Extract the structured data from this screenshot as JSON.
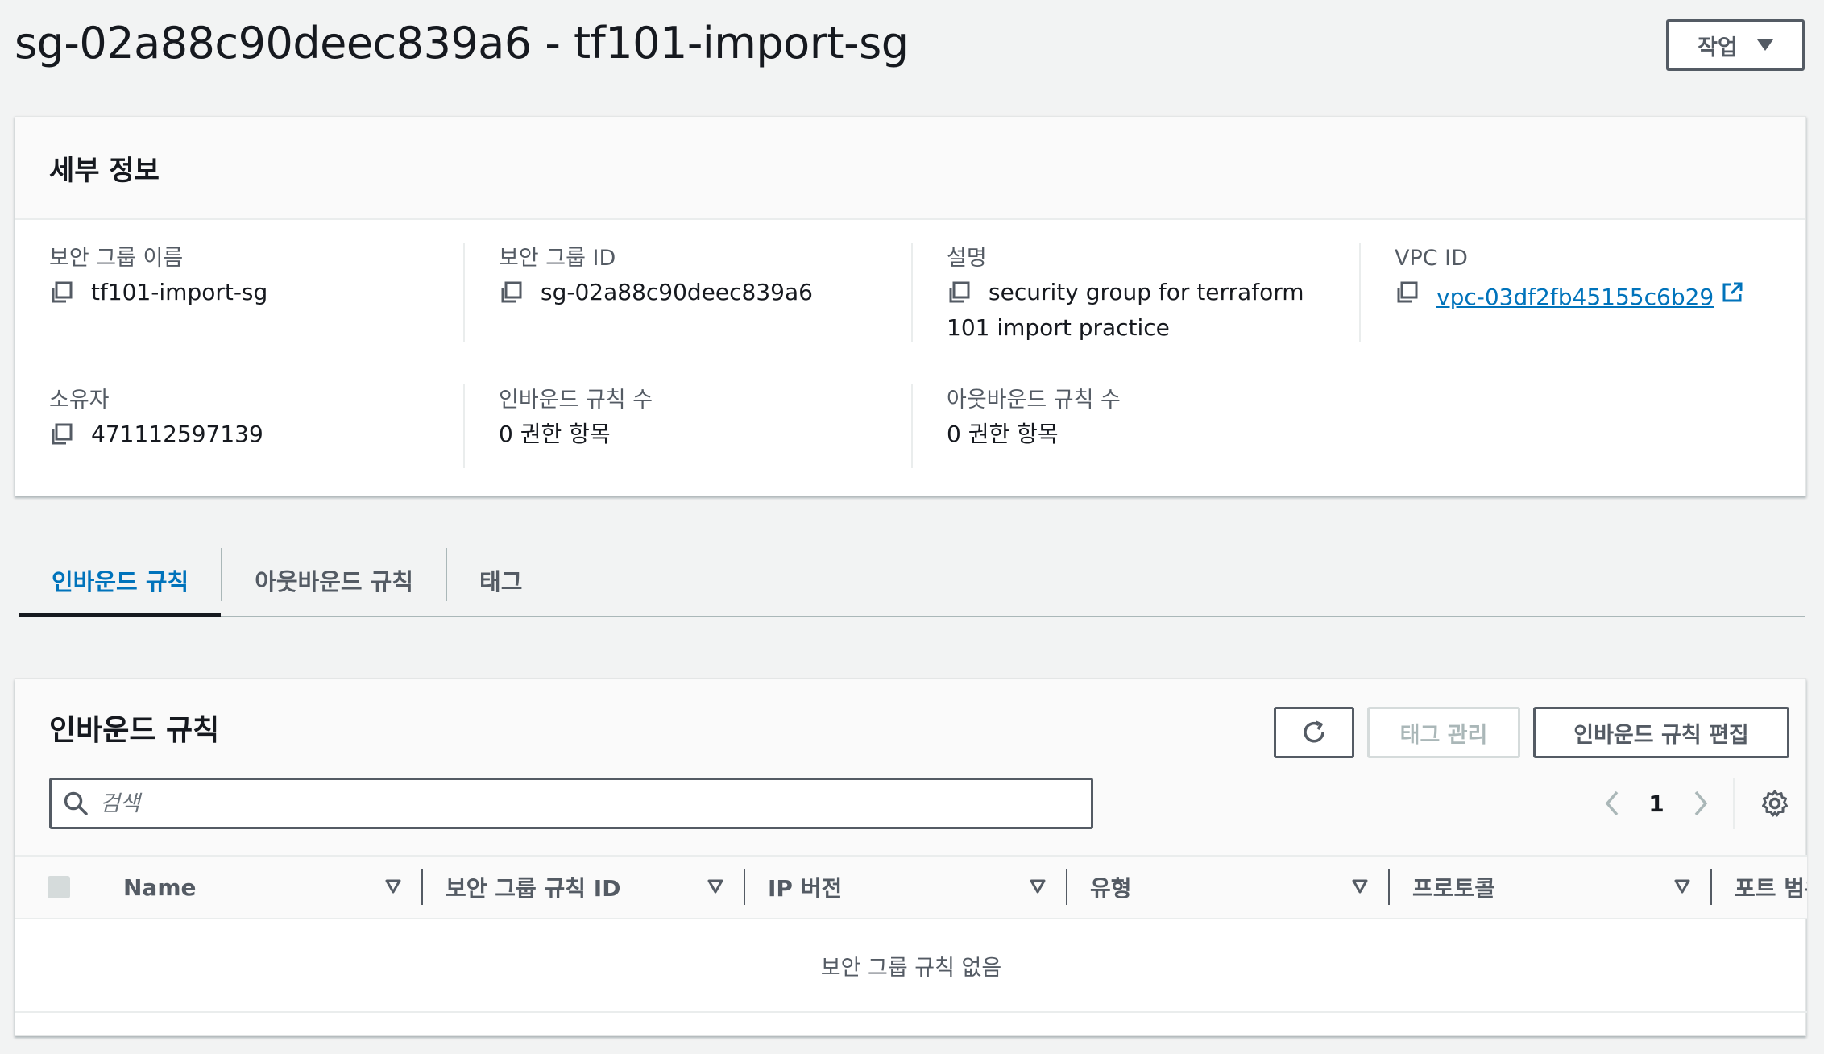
{
  "page": {
    "title": "sg-02a88c90deec839a6 - tf101-import-sg",
    "actions_label": "작업"
  },
  "details": {
    "heading": "세부 정보",
    "sg_name_label": "보안 그룹 이름",
    "sg_name_value": "tf101-import-sg",
    "sg_id_label": "보안 그룹 ID",
    "sg_id_value": "sg-02a88c90deec839a6",
    "description_label": "설명",
    "description_value": "security group for terraform 101 import practice",
    "vpc_id_label": "VPC ID",
    "vpc_id_value": "vpc-03df2fb45155c6b29",
    "owner_label": "소유자",
    "owner_value": "471112597139",
    "inbound_count_label": "인바운드 규칙 수",
    "inbound_count_value": "0 권한 항목",
    "outbound_count_label": "아웃바운드 규칙 수",
    "outbound_count_value": "0 권한 항목"
  },
  "tabs": [
    {
      "label": "인바운드 규칙",
      "active": true
    },
    {
      "label": "아웃바운드 규칙",
      "active": false
    },
    {
      "label": "태그",
      "active": false
    }
  ],
  "rules": {
    "title": "인바운드 규칙",
    "manage_tags_label": "태그 관리",
    "edit_rules_label": "인바운드 규칙 편집",
    "search_placeholder": "검색",
    "current_page": "1",
    "columns": [
      "Name",
      "보안 그룹 규칙 ID",
      "IP 버전",
      "유형",
      "프로토콜",
      "포트 범위"
    ],
    "empty_text": "보안 그룹 규칙 없음"
  },
  "colors": {
    "link": "#0073bb",
    "text": "#16191f",
    "muted": "#545b64",
    "disabled": "#aab7b8",
    "background": "#f2f3f3"
  },
  "icons": {
    "copy": "copy-icon",
    "external_link": "external-link-icon",
    "refresh": "refresh-icon",
    "search": "search-icon",
    "chevron_left": "chevron-left-icon",
    "chevron_right": "chevron-right-icon",
    "settings": "gear-icon",
    "sort": "sort-down-icon",
    "dropdown": "caret-down-icon"
  }
}
